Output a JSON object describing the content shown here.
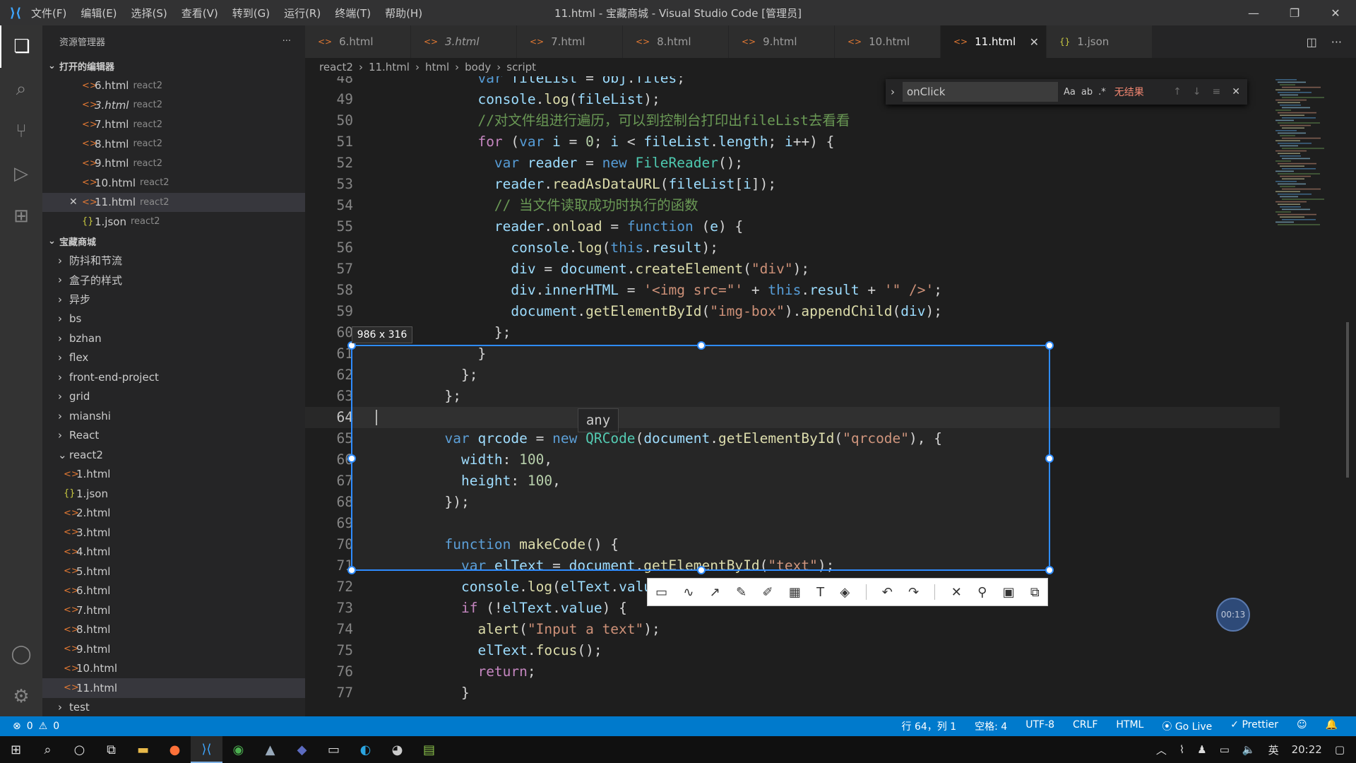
{
  "window": {
    "title": "11.html - 宝藏商城 - Visual Studio Code [管理员]",
    "menu": [
      "文件(F)",
      "编辑(E)",
      "选择(S)",
      "查看(V)",
      "转到(G)",
      "运行(R)",
      "终端(T)",
      "帮助(H)"
    ]
  },
  "sidebar": {
    "title": "资源管理器",
    "open_editors_label": "打开的编辑器",
    "open_editors": [
      {
        "name": "6.html",
        "hint": "react2",
        "type": "html"
      },
      {
        "name": "3.html",
        "hint": "react2",
        "type": "html"
      },
      {
        "name": "7.html",
        "hint": "react2",
        "type": "html"
      },
      {
        "name": "8.html",
        "hint": "react2",
        "type": "html"
      },
      {
        "name": "9.html",
        "hint": "react2",
        "type": "html"
      },
      {
        "name": "10.html",
        "hint": "react2",
        "type": "html"
      },
      {
        "name": "11.html",
        "hint": "react2",
        "type": "html"
      },
      {
        "name": "1.json",
        "hint": "react2",
        "type": "json"
      }
    ],
    "project_label": "宝藏商城",
    "folders": [
      "防抖和节流",
      "盒子的样式",
      "异步",
      "bs",
      "bzhan",
      "flex",
      "front-end-project",
      "grid",
      "mianshi",
      "React"
    ],
    "react2_label": "react2",
    "react2_files": [
      {
        "name": "1.html",
        "type": "html"
      },
      {
        "name": "1.json",
        "type": "json"
      },
      {
        "name": "2.html",
        "type": "html"
      },
      {
        "name": "3.html",
        "type": "html"
      },
      {
        "name": "4.html",
        "type": "html"
      },
      {
        "name": "5.html",
        "type": "html"
      },
      {
        "name": "6.html",
        "type": "html"
      },
      {
        "name": "7.html",
        "type": "html"
      },
      {
        "name": "8.html",
        "type": "html"
      },
      {
        "name": "9.html",
        "type": "html"
      },
      {
        "name": "10.html",
        "type": "html"
      },
      {
        "name": "11.html",
        "type": "html"
      }
    ],
    "test_label": "test"
  },
  "tabs": [
    {
      "name": "6.html",
      "type": "html"
    },
    {
      "name": "3.html",
      "type": "html"
    },
    {
      "name": "7.html",
      "type": "html"
    },
    {
      "name": "8.html",
      "type": "html"
    },
    {
      "name": "9.html",
      "type": "html"
    },
    {
      "name": "10.html",
      "type": "html"
    },
    {
      "name": "11.html",
      "type": "html",
      "active": true
    },
    {
      "name": "1.json",
      "type": "json"
    }
  ],
  "breadcrumb": [
    "react2",
    "11.html",
    "html",
    "body",
    "script"
  ],
  "find": {
    "query": "onClick",
    "opt_case": "Aa",
    "opt_word": "ab",
    "opt_regex": ".*",
    "result": "无结果"
  },
  "code_lines": [
    {
      "n": "48",
      "t": [
        [
          "      ",
          ""
        ],
        [
          "var ",
          "kw"
        ],
        [
          "fileList",
          "vr"
        ],
        [
          " = ",
          ""
        ],
        [
          "obj",
          "vr"
        ],
        [
          ".",
          ""
        ],
        [
          "files",
          "vr"
        ],
        [
          ";",
          ""
        ]
      ]
    },
    {
      "n": "49",
      "t": [
        [
          "      ",
          ""
        ],
        [
          "console",
          "vr"
        ],
        [
          ".",
          ""
        ],
        [
          "log",
          "fn"
        ],
        [
          "(",
          ""
        ],
        [
          "fileList",
          "vr"
        ],
        [
          ");",
          ""
        ]
      ]
    },
    {
      "n": "50",
      "t": [
        [
          "      ",
          ""
        ],
        [
          "//对文件组进行遍历，可以到控制台打印出fileList去看看",
          "cm"
        ]
      ]
    },
    {
      "n": "51",
      "t": [
        [
          "      ",
          ""
        ],
        [
          "for",
          "fl"
        ],
        [
          " (",
          ""
        ],
        [
          "var ",
          "kw"
        ],
        [
          "i",
          "vr"
        ],
        [
          " = ",
          ""
        ],
        [
          "0",
          "nm"
        ],
        [
          "; ",
          ""
        ],
        [
          "i",
          "vr"
        ],
        [
          " < ",
          ""
        ],
        [
          "fileList",
          "vr"
        ],
        [
          ".",
          ""
        ],
        [
          "length",
          "vr"
        ],
        [
          "; ",
          ""
        ],
        [
          "i",
          "vr"
        ],
        [
          "++) {",
          ""
        ]
      ]
    },
    {
      "n": "52",
      "t": [
        [
          "        ",
          ""
        ],
        [
          "var ",
          "kw"
        ],
        [
          "reader",
          "vr"
        ],
        [
          " = ",
          ""
        ],
        [
          "new ",
          "kw"
        ],
        [
          "FileReader",
          "cl"
        ],
        [
          "();",
          ""
        ]
      ]
    },
    {
      "n": "53",
      "t": [
        [
          "        ",
          ""
        ],
        [
          "reader",
          "vr"
        ],
        [
          ".",
          ""
        ],
        [
          "readAsDataURL",
          "fn"
        ],
        [
          "(",
          ""
        ],
        [
          "fileList",
          "vr"
        ],
        [
          "[",
          ""
        ],
        [
          "i",
          "vr"
        ],
        [
          "]);",
          ""
        ]
      ]
    },
    {
      "n": "54",
      "t": [
        [
          "        ",
          ""
        ],
        [
          "// 当文件读取成功时执行的函数",
          "cm"
        ]
      ]
    },
    {
      "n": "55",
      "t": [
        [
          "        ",
          ""
        ],
        [
          "reader",
          "vr"
        ],
        [
          ".",
          ""
        ],
        [
          "onload",
          "fn"
        ],
        [
          " = ",
          ""
        ],
        [
          "function ",
          "kw"
        ],
        [
          "(",
          ""
        ],
        [
          "e",
          "vr"
        ],
        [
          ") {",
          ""
        ]
      ]
    },
    {
      "n": "56",
      "t": [
        [
          "          ",
          ""
        ],
        [
          "console",
          "vr"
        ],
        [
          ".",
          ""
        ],
        [
          "log",
          "fn"
        ],
        [
          "(",
          ""
        ],
        [
          "this",
          "kw"
        ],
        [
          ".",
          ""
        ],
        [
          "result",
          "vr"
        ],
        [
          ");",
          ""
        ]
      ]
    },
    {
      "n": "57",
      "t": [
        [
          "          ",
          ""
        ],
        [
          "div",
          "vr"
        ],
        [
          " = ",
          ""
        ],
        [
          "document",
          "vr"
        ],
        [
          ".",
          ""
        ],
        [
          "createElement",
          "fn"
        ],
        [
          "(",
          ""
        ],
        [
          "\"div\"",
          "st"
        ],
        [
          ");",
          ""
        ]
      ]
    },
    {
      "n": "58",
      "t": [
        [
          "          ",
          ""
        ],
        [
          "div",
          "vr"
        ],
        [
          ".",
          ""
        ],
        [
          "innerHTML",
          "vr"
        ],
        [
          " = ",
          ""
        ],
        [
          "'<img src=\"'",
          "st"
        ],
        [
          " + ",
          ""
        ],
        [
          "this",
          "kw"
        ],
        [
          ".",
          ""
        ],
        [
          "result",
          "vr"
        ],
        [
          " + ",
          ""
        ],
        [
          "'\" />'",
          "st"
        ],
        [
          ";",
          ""
        ]
      ]
    },
    {
      "n": "59",
      "t": [
        [
          "          ",
          ""
        ],
        [
          "document",
          "vr"
        ],
        [
          ".",
          ""
        ],
        [
          "getElementById",
          "fn"
        ],
        [
          "(",
          ""
        ],
        [
          "\"img-box\"",
          "st"
        ],
        [
          ").",
          ""
        ],
        [
          "appendChild",
          "fn"
        ],
        [
          "(",
          ""
        ],
        [
          "div",
          "vr"
        ],
        [
          ");",
          ""
        ]
      ]
    },
    {
      "n": "60",
      "t": [
        [
          "        };",
          ""
        ]
      ]
    },
    {
      "n": "61",
      "t": [
        [
          "      }",
          ""
        ]
      ]
    },
    {
      "n": "62",
      "t": [
        [
          "    };",
          ""
        ]
      ]
    },
    {
      "n": "63",
      "t": [
        [
          "  };",
          ""
        ]
      ]
    },
    {
      "n": "64",
      "t": [
        [
          "",
          ""
        ]
      ],
      "cur": true
    },
    {
      "n": "65",
      "t": [
        [
          "  ",
          ""
        ],
        [
          "var ",
          "kw"
        ],
        [
          "qrcode",
          "vr"
        ],
        [
          " = ",
          ""
        ],
        [
          "new ",
          "kw"
        ],
        [
          "QRCode",
          "cl"
        ],
        [
          "(",
          ""
        ],
        [
          "document",
          "vr"
        ],
        [
          ".",
          ""
        ],
        [
          "getElementById",
          "fn"
        ],
        [
          "(",
          ""
        ],
        [
          "\"qrcode\"",
          "st"
        ],
        [
          "), {",
          ""
        ]
      ]
    },
    {
      "n": "66",
      "t": [
        [
          "    ",
          ""
        ],
        [
          "width",
          "vr"
        ],
        [
          ": ",
          ""
        ],
        [
          "100",
          "nm"
        ],
        [
          ",",
          ""
        ]
      ]
    },
    {
      "n": "67",
      "t": [
        [
          "    ",
          ""
        ],
        [
          "height",
          "vr"
        ],
        [
          ": ",
          ""
        ],
        [
          "100",
          "nm"
        ],
        [
          ",",
          ""
        ]
      ]
    },
    {
      "n": "68",
      "t": [
        [
          "  });",
          ""
        ]
      ]
    },
    {
      "n": "69",
      "t": [
        [
          "",
          ""
        ]
      ]
    },
    {
      "n": "70",
      "t": [
        [
          "  ",
          ""
        ],
        [
          "function ",
          "kw"
        ],
        [
          "makeCode",
          "fn"
        ],
        [
          "() {",
          ""
        ]
      ]
    },
    {
      "n": "71",
      "t": [
        [
          "    ",
          ""
        ],
        [
          "var ",
          "kw"
        ],
        [
          "elText",
          "vr"
        ],
        [
          " = ",
          ""
        ],
        [
          "document",
          "vr"
        ],
        [
          ".",
          ""
        ],
        [
          "getElementById",
          "fn"
        ],
        [
          "(",
          ""
        ],
        [
          "\"text\"",
          "st"
        ],
        [
          ");",
          ""
        ]
      ]
    },
    {
      "n": "72",
      "t": [
        [
          "    ",
          ""
        ],
        [
          "console",
          "vr"
        ],
        [
          ".",
          ""
        ],
        [
          "log",
          "fn"
        ],
        [
          "(",
          ""
        ],
        [
          "elText",
          "vr"
        ],
        [
          ".",
          ""
        ],
        [
          "value",
          "vr"
        ],
        [
          ");",
          ""
        ]
      ]
    },
    {
      "n": "73",
      "t": [
        [
          "    ",
          ""
        ],
        [
          "if",
          "fl"
        ],
        [
          " (!",
          ""
        ],
        [
          "elText",
          "vr"
        ],
        [
          ".",
          ""
        ],
        [
          "value",
          "vr"
        ],
        [
          ") {",
          ""
        ]
      ]
    },
    {
      "n": "74",
      "t": [
        [
          "      ",
          ""
        ],
        [
          "alert",
          "fn"
        ],
        [
          "(",
          ""
        ],
        [
          "\"Input a text\"",
          "st"
        ],
        [
          ");",
          ""
        ]
      ]
    },
    {
      "n": "75",
      "t": [
        [
          "      ",
          ""
        ],
        [
          "elText",
          "vr"
        ],
        [
          ".",
          ""
        ],
        [
          "focus",
          "fn"
        ],
        [
          "();",
          ""
        ]
      ]
    },
    {
      "n": "76",
      "t": [
        [
          "      ",
          ""
        ],
        [
          "return",
          "fl"
        ],
        [
          ";",
          ""
        ]
      ]
    },
    {
      "n": "77",
      "t": [
        [
          "    }",
          ""
        ]
      ]
    }
  ],
  "overlay": {
    "size_label": "986 x 316",
    "hover_type": "any",
    "timer": "00:13"
  },
  "statusbar": {
    "errors": "0",
    "warnings": "0",
    "position": "行 64，列 1",
    "spaces": "空格: 4",
    "encoding": "UTF-8",
    "eol": "CRLF",
    "language": "HTML",
    "golive": "Go Live",
    "prettier": "Prettier"
  },
  "taskbar": {
    "ime": "英",
    "time": "20:22"
  }
}
